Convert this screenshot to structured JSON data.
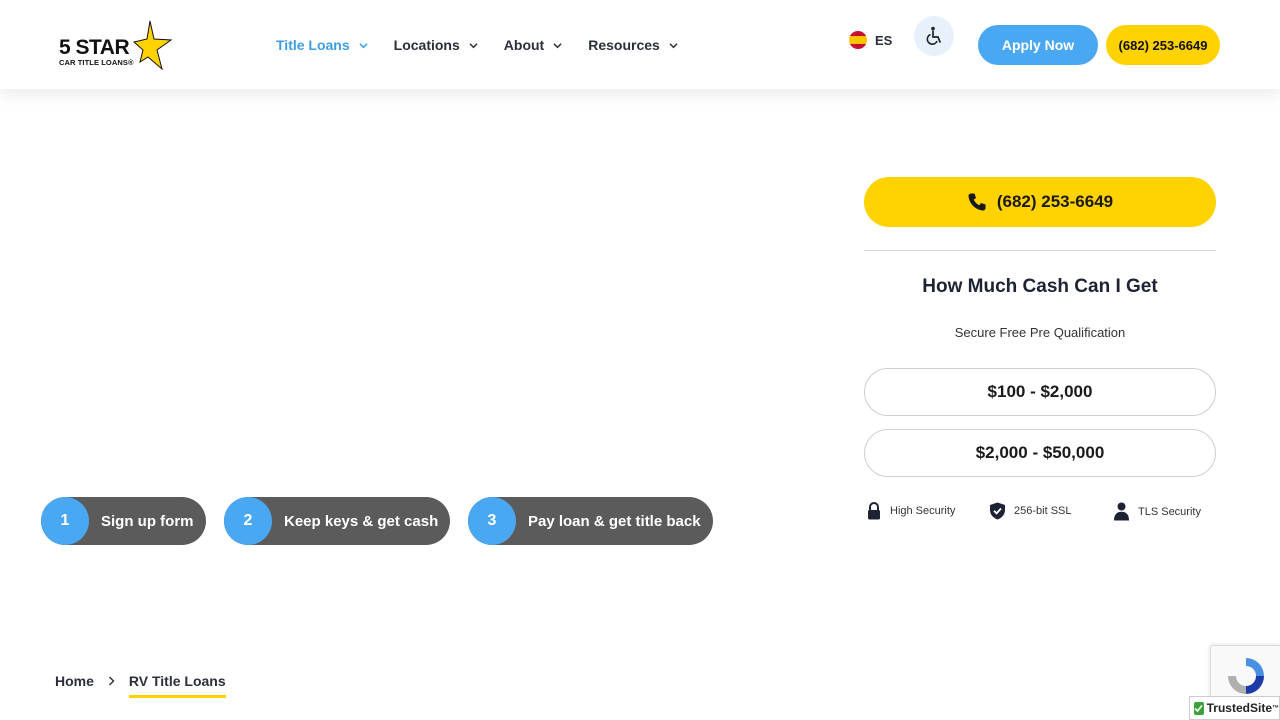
{
  "logo": {
    "main": "5 STAR",
    "sub": "CAR TITLE LOANS®"
  },
  "nav": {
    "items": [
      {
        "label": "Title Loans",
        "active": true
      },
      {
        "label": "Locations",
        "active": false
      },
      {
        "label": "About",
        "active": false
      },
      {
        "label": "Resources",
        "active": false
      }
    ]
  },
  "language": {
    "label": "ES"
  },
  "header_buttons": {
    "apply": "Apply Now",
    "phone": "(682) 253-6649"
  },
  "steps": [
    {
      "number": "1",
      "label": "Sign up form"
    },
    {
      "number": "2",
      "label": "Keep keys & get cash"
    },
    {
      "number": "3",
      "label": "Pay loan & get title back"
    }
  ],
  "sidebar": {
    "phone": "(682) 253-6649",
    "title": "How Much Cash Can I Get",
    "subtitle": "Secure Free Pre Qualification",
    "ranges": [
      "$100 - $2,000",
      "$2,000 - $50,000"
    ],
    "security": [
      {
        "label": "High Security",
        "icon": "lock-icon"
      },
      {
        "label": "256-bit SSL",
        "icon": "shield-check-icon"
      },
      {
        "label": "TLS Security",
        "icon": "person-icon"
      }
    ]
  },
  "breadcrumb": {
    "home": "Home",
    "current": "RV Title Loans"
  },
  "trusted_site": {
    "label": "TrustedSite"
  },
  "colors": {
    "accent_blue": "#4aa8f3",
    "accent_yellow": "#ffd200",
    "step_gray": "#5b5b5b",
    "nav_active": "#3d9ee8"
  }
}
